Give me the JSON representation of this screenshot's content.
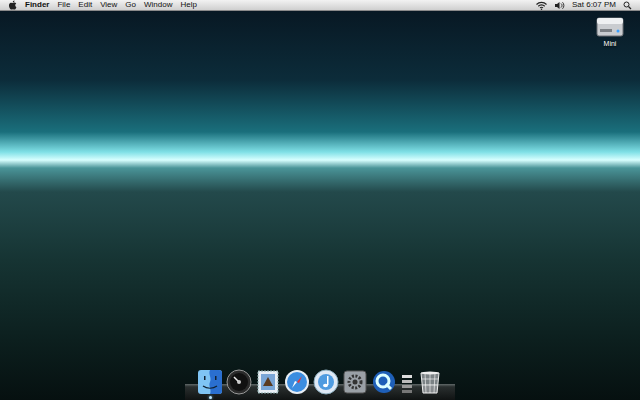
{
  "menu_bar": {
    "app": "Finder",
    "menus": [
      "File",
      "Edit",
      "View",
      "Go",
      "Window",
      "Help"
    ],
    "clock": "Sat 6:07 PM"
  },
  "desktop_icons": [
    {
      "label": "Mini"
    }
  ],
  "dock": {
    "items": [
      {
        "running": true
      },
      {
        "running": false
      },
      {
        "running": false
      },
      {
        "running": false
      },
      {
        "running": false
      },
      {
        "running": false
      },
      {
        "running": false
      },
      {
        "running": false
      },
      {
        "running": false
      }
    ]
  }
}
